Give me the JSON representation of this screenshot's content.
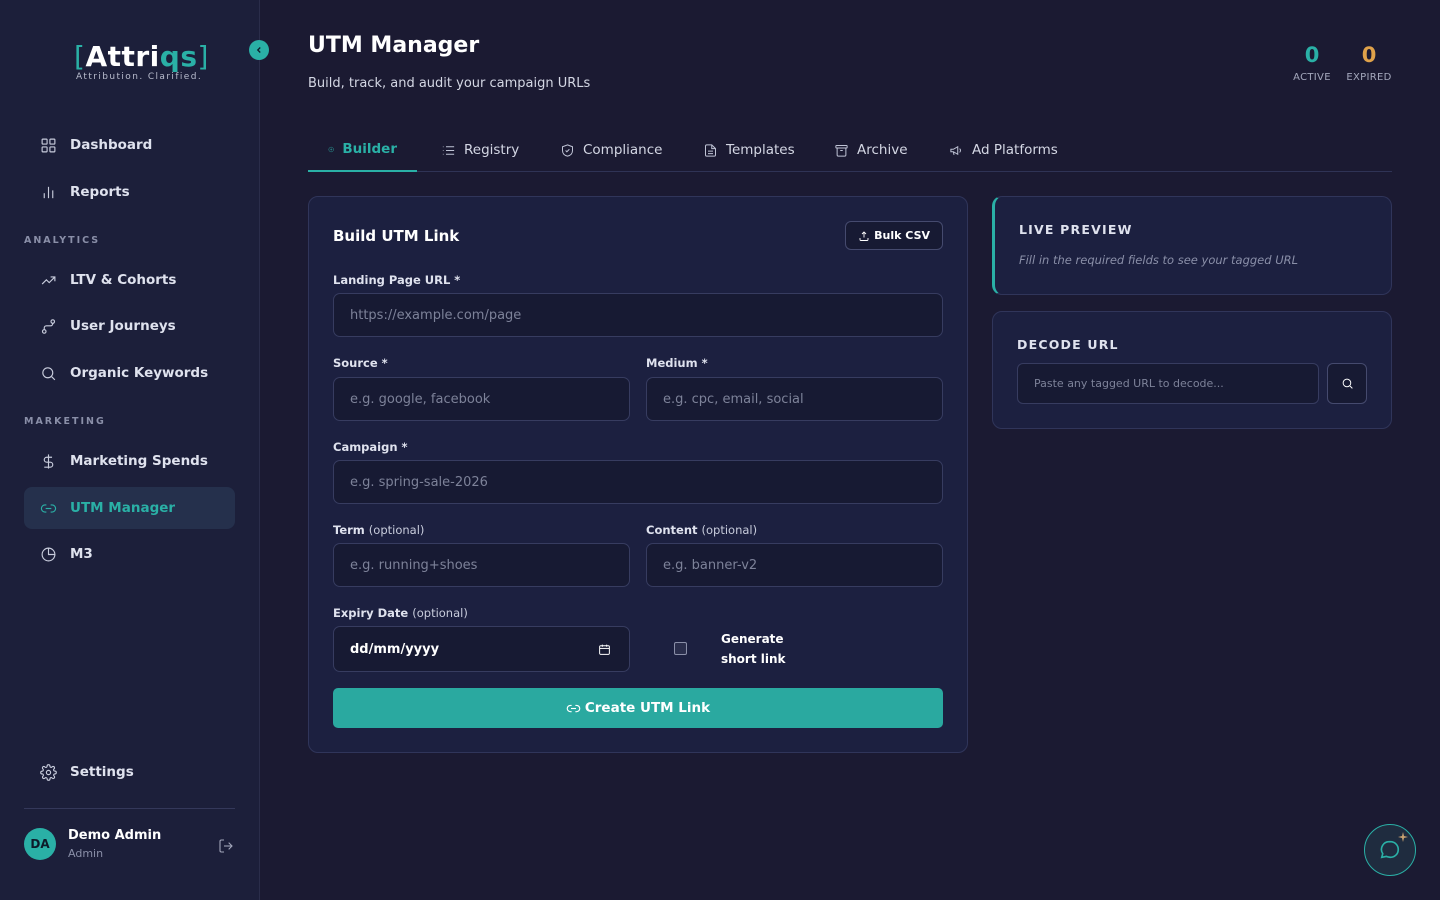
{
  "brand": {
    "bracket_open": "[",
    "name_part1": "Attri",
    "name_part2": "qs",
    "bracket_close": "]",
    "tagline": "Attribution. Clarified.",
    "accent_color": "#2ab0a6"
  },
  "sidebar": {
    "collapse_icon": "chevron-left-icon",
    "items_top": [
      {
        "label": "Dashboard",
        "icon": "grid-icon"
      },
      {
        "label": "Reports",
        "icon": "bar-chart-icon"
      }
    ],
    "analytics_label": "ANALYTICS",
    "analytics_items": [
      {
        "label": "LTV & Cohorts",
        "icon": "trend-up-icon"
      },
      {
        "label": "User Journeys",
        "icon": "route-icon"
      },
      {
        "label": "Organic Keywords",
        "icon": "search-icon"
      }
    ],
    "marketing_label": "MARKETING",
    "marketing_items": [
      {
        "label": "Marketing Spends",
        "icon": "dollar-icon"
      },
      {
        "label": "UTM Manager",
        "icon": "link-icon",
        "active": true
      },
      {
        "label": "M3",
        "icon": "pie-chart-icon"
      }
    ],
    "settings_label": "Settings",
    "user": {
      "initials": "DA",
      "name": "Demo Admin",
      "role": "Admin"
    }
  },
  "header": {
    "title": "UTM Manager",
    "subtitle": "Build, track, and audit your campaign URLs",
    "stats": [
      {
        "value": "0",
        "label": "ACTIVE",
        "color": "#2ab0a6"
      },
      {
        "value": "0",
        "label": "EXPIRED",
        "color": "#e0a24a"
      }
    ]
  },
  "tabs": [
    {
      "label": "Builder",
      "icon": "plus-circle-icon",
      "active": true
    },
    {
      "label": "Registry",
      "icon": "list-icon"
    },
    {
      "label": "Compliance",
      "icon": "shield-icon"
    },
    {
      "label": "Templates",
      "icon": "document-icon"
    },
    {
      "label": "Archive",
      "icon": "archive-icon"
    },
    {
      "label": "Ad Platforms",
      "icon": "megaphone-icon"
    }
  ],
  "builder": {
    "title": "Build UTM Link",
    "bulk_csv_label": "Bulk CSV",
    "landing_label": "Landing Page URL *",
    "landing_placeholder": "https://example.com/page",
    "source_label": "Source *",
    "source_placeholder": "e.g. google, facebook",
    "medium_label": "Medium *",
    "medium_placeholder": "e.g. cpc, email, social",
    "campaign_label": "Campaign *",
    "campaign_placeholder": "e.g. spring-sale-2026",
    "term_label": "Term",
    "term_optional": "(optional)",
    "term_placeholder": "e.g. running+shoes",
    "content_label": "Content",
    "content_optional": "(optional)",
    "content_placeholder": "e.g. banner-v2",
    "expiry_label": "Expiry Date",
    "expiry_optional": "(optional)",
    "expiry_value": "dd/mm/yyyy",
    "short_link_label": "Generate short link",
    "short_link_checked": false,
    "create_label": "Create UTM Link"
  },
  "preview": {
    "title": "LIVE PREVIEW",
    "text": "Fill in the required fields to see your tagged URL"
  },
  "decode": {
    "title": "DECODE URL",
    "placeholder": "Paste any tagged URL to decode..."
  }
}
